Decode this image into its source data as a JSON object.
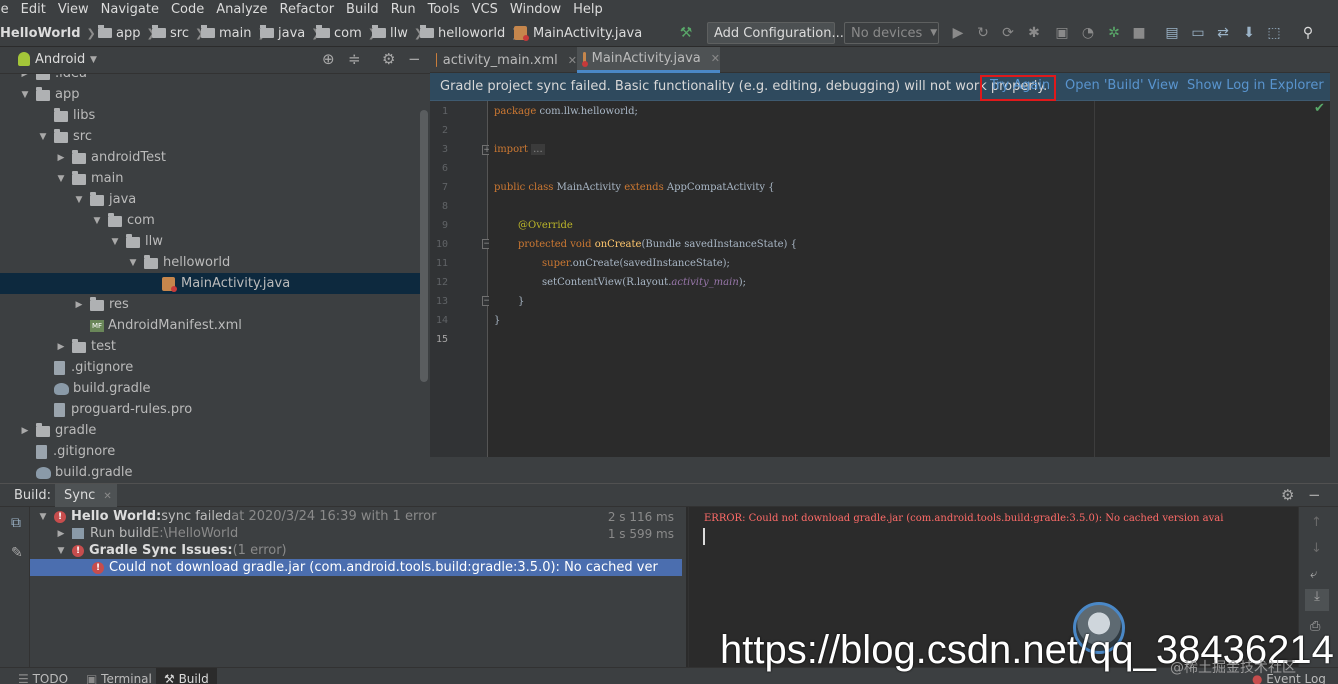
{
  "menu": [
    "le",
    "Edit",
    "View",
    "Navigate",
    "Code",
    "Analyze",
    "Refactor",
    "Build",
    "Run",
    "Tools",
    "VCS",
    "Window",
    "Help"
  ],
  "breadcrumbs": [
    "HelloWorld",
    "app",
    "src",
    "main",
    "java",
    "com",
    "llw",
    "helloworld",
    "MainActivity.java"
  ],
  "toolbar": {
    "add_config": "Add Configuration...",
    "devices": "No devices"
  },
  "project": {
    "view": "Android",
    "tree": [
      {
        "label": ".idea",
        "depth": 1,
        "kind": "folder",
        "arrow": "right"
      },
      {
        "label": "app",
        "depth": 1,
        "kind": "folder",
        "arrow": "down"
      },
      {
        "label": "libs",
        "depth": 2,
        "kind": "folder",
        "arrow": ""
      },
      {
        "label": "src",
        "depth": 2,
        "kind": "folder",
        "arrow": "down"
      },
      {
        "label": "androidTest",
        "depth": 3,
        "kind": "folder",
        "arrow": "right"
      },
      {
        "label": "main",
        "depth": 3,
        "kind": "folder",
        "arrow": "down"
      },
      {
        "label": "java",
        "depth": 4,
        "kind": "folder",
        "arrow": "down"
      },
      {
        "label": "com",
        "depth": 5,
        "kind": "folder",
        "arrow": "down"
      },
      {
        "label": "llw",
        "depth": 6,
        "kind": "folder",
        "arrow": "down"
      },
      {
        "label": "helloworld",
        "depth": 7,
        "kind": "folder",
        "arrow": "down"
      },
      {
        "label": "MainActivity.java",
        "depth": 8,
        "kind": "java",
        "arrow": "",
        "selected": true
      },
      {
        "label": "res",
        "depth": 4,
        "kind": "folder",
        "arrow": "right"
      },
      {
        "label": "AndroidManifest.xml",
        "depth": 4,
        "kind": "manifest",
        "arrow": ""
      },
      {
        "label": "test",
        "depth": 3,
        "kind": "folder",
        "arrow": "right"
      },
      {
        "label": ".gitignore",
        "depth": 2,
        "kind": "file",
        "arrow": ""
      },
      {
        "label": "build.gradle",
        "depth": 2,
        "kind": "gradle",
        "arrow": ""
      },
      {
        "label": "proguard-rules.pro",
        "depth": 2,
        "kind": "file",
        "arrow": ""
      },
      {
        "label": "gradle",
        "depth": 1,
        "kind": "folder",
        "arrow": "right"
      },
      {
        "label": ".gitignore",
        "depth": 1,
        "kind": "file",
        "arrow": ""
      },
      {
        "label": "build.gradle",
        "depth": 1,
        "kind": "gradle",
        "arrow": ""
      }
    ]
  },
  "editor_tabs": [
    {
      "label": "activity_main.xml",
      "active": false
    },
    {
      "label": "MainActivity.java",
      "active": true
    }
  ],
  "banner": {
    "message": "Gradle project sync failed. Basic functionality (e.g. editing, debugging) will not work properly.",
    "try_again": "Try Again",
    "open_build": "Open 'Build' View",
    "show_log": "Show Log in Explorer"
  },
  "code": {
    "line_numbers": [
      "1",
      "2",
      "3",
      "6",
      "7",
      "8",
      "9",
      "10",
      "11",
      "12",
      "13",
      "14",
      "15"
    ],
    "package_kw": "package",
    "package_name": "com.llw.helloworld;",
    "import_kw": "import",
    "import_fold": "...",
    "public_kw": "public class",
    "class_name": "MainActivity",
    "extends_kw": "extends",
    "parent": "AppCompatActivity {",
    "override": "@Override",
    "protected_kw": "protected void",
    "method": "onCreate",
    "params": "(Bundle savedInstanceState) {",
    "super_kw": "super",
    "super_call": ".onCreate(savedInstanceState);",
    "set_content": "setContentView(R.layout.",
    "layout_ref": "activity_main",
    "set_content_end": ");",
    "close_inner": "}",
    "close_outer": "}"
  },
  "build_panel": {
    "label": "Build:",
    "tab": "Sync",
    "rows": [
      {
        "bold": "Hello World:",
        "text": " sync failed",
        "muted": " at 2020/3/24 16:39  with 1 error",
        "time": "2 s 116 ms"
      },
      {
        "bold": "",
        "text": "Run build ",
        "muted": "E:\\HelloWorld",
        "time": "1 s 599 ms"
      },
      {
        "bold": "Gradle Sync Issues:",
        "text": "",
        "muted": " (1 error)",
        "time": ""
      },
      {
        "bold": "",
        "text": "Could not download gradle.jar (com.android.tools.build:gradle:3.5.0): No cached ver",
        "muted": "",
        "time": ""
      }
    ],
    "log": "ERROR: Could not download gradle.jar (com.android.tools.build:gradle:3.5.0): No cached version avai"
  },
  "status_tabs": [
    "TODO",
    "Terminal",
    "Build"
  ],
  "event_log": "Event Log",
  "watermark": "https://blog.csdn.net/qq_38436214",
  "watermark_small": "@稀土掘金技术社区",
  "colors": {
    "accent": "#4a88c7",
    "error": "#c74d4d",
    "highlight_box": "#e0191b"
  }
}
